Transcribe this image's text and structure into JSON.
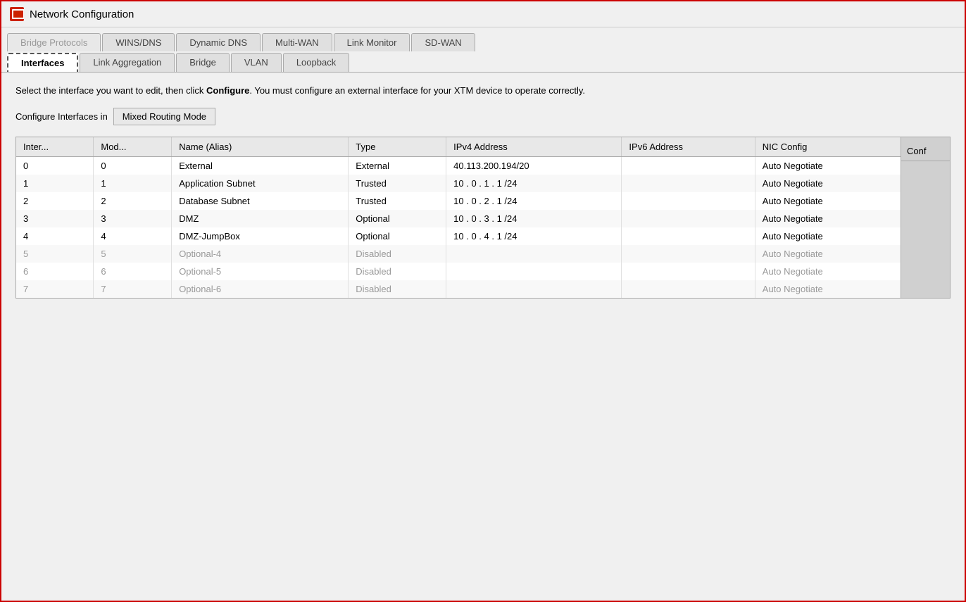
{
  "window": {
    "title": "Network Configuration"
  },
  "tabs_row1": [
    {
      "label": "Bridge Protocols",
      "active": false,
      "disabled": true
    },
    {
      "label": "WINS/DNS",
      "active": false,
      "disabled": false
    },
    {
      "label": "Dynamic DNS",
      "active": false,
      "disabled": false
    },
    {
      "label": "Multi-WAN",
      "active": false,
      "disabled": false
    },
    {
      "label": "Link Monitor",
      "active": false,
      "disabled": false
    },
    {
      "label": "SD-WAN",
      "active": false,
      "disabled": false
    }
  ],
  "tabs_row2": [
    {
      "label": "Interfaces",
      "active": true,
      "disabled": false
    },
    {
      "label": "Link Aggregation",
      "active": false,
      "disabled": false
    },
    {
      "label": "Bridge",
      "active": false,
      "disabled": false
    },
    {
      "label": "VLAN",
      "active": false,
      "disabled": false
    },
    {
      "label": "Loopback",
      "active": false,
      "disabled": false
    }
  ],
  "description": "Select the interface you want to edit, then click Configure. You must configure an external interface for your XTM device to operate correctly.",
  "description_bold": "Configure",
  "routing_mode_label": "Configure Interfaces in",
  "routing_mode_value": "Mixed Routing Mode",
  "table": {
    "columns": [
      "Inter...",
      "Mod...",
      "Name (Alias)",
      "Type",
      "IPv4 Address",
      "IPv6 Address",
      "NIC Config"
    ],
    "configure_col": "Conf",
    "rows": [
      {
        "interface": "0",
        "mod": "0",
        "name": "External",
        "type": "External",
        "ipv4": "40.113.200.194/20",
        "ipv6": "",
        "nic": "Auto Negotiate",
        "disabled": false
      },
      {
        "interface": "1",
        "mod": "1",
        "name": "Application Subnet",
        "type": "Trusted",
        "ipv4": "10 . 0 . 1 . 1 /24",
        "ipv6": "",
        "nic": "Auto Negotiate",
        "disabled": false
      },
      {
        "interface": "2",
        "mod": "2",
        "name": "Database Subnet",
        "type": "Trusted",
        "ipv4": "10 . 0 . 2 . 1 /24",
        "ipv6": "",
        "nic": "Auto Negotiate",
        "disabled": false
      },
      {
        "interface": "3",
        "mod": "3",
        "name": "DMZ",
        "type": "Optional",
        "ipv4": "10 . 0 . 3 . 1 /24",
        "ipv6": "",
        "nic": "Auto Negotiate",
        "disabled": false
      },
      {
        "interface": "4",
        "mod": "4",
        "name": "DMZ-JumpBox",
        "type": "Optional",
        "ipv4": "10 . 0 . 4 . 1 /24",
        "ipv6": "",
        "nic": "Auto Negotiate",
        "disabled": false
      },
      {
        "interface": "5",
        "mod": "5",
        "name": "Optional-4",
        "type": "Disabled",
        "ipv4": "",
        "ipv6": "",
        "nic": "Auto Negotiate",
        "disabled": true
      },
      {
        "interface": "6",
        "mod": "6",
        "name": "Optional-5",
        "type": "Disabled",
        "ipv4": "",
        "ipv6": "",
        "nic": "Auto Negotiate",
        "disabled": true
      },
      {
        "interface": "7",
        "mod": "7",
        "name": "Optional-6",
        "type": "Disabled",
        "ipv4": "",
        "ipv6": "",
        "nic": "Auto Negotiate",
        "disabled": true
      }
    ]
  }
}
